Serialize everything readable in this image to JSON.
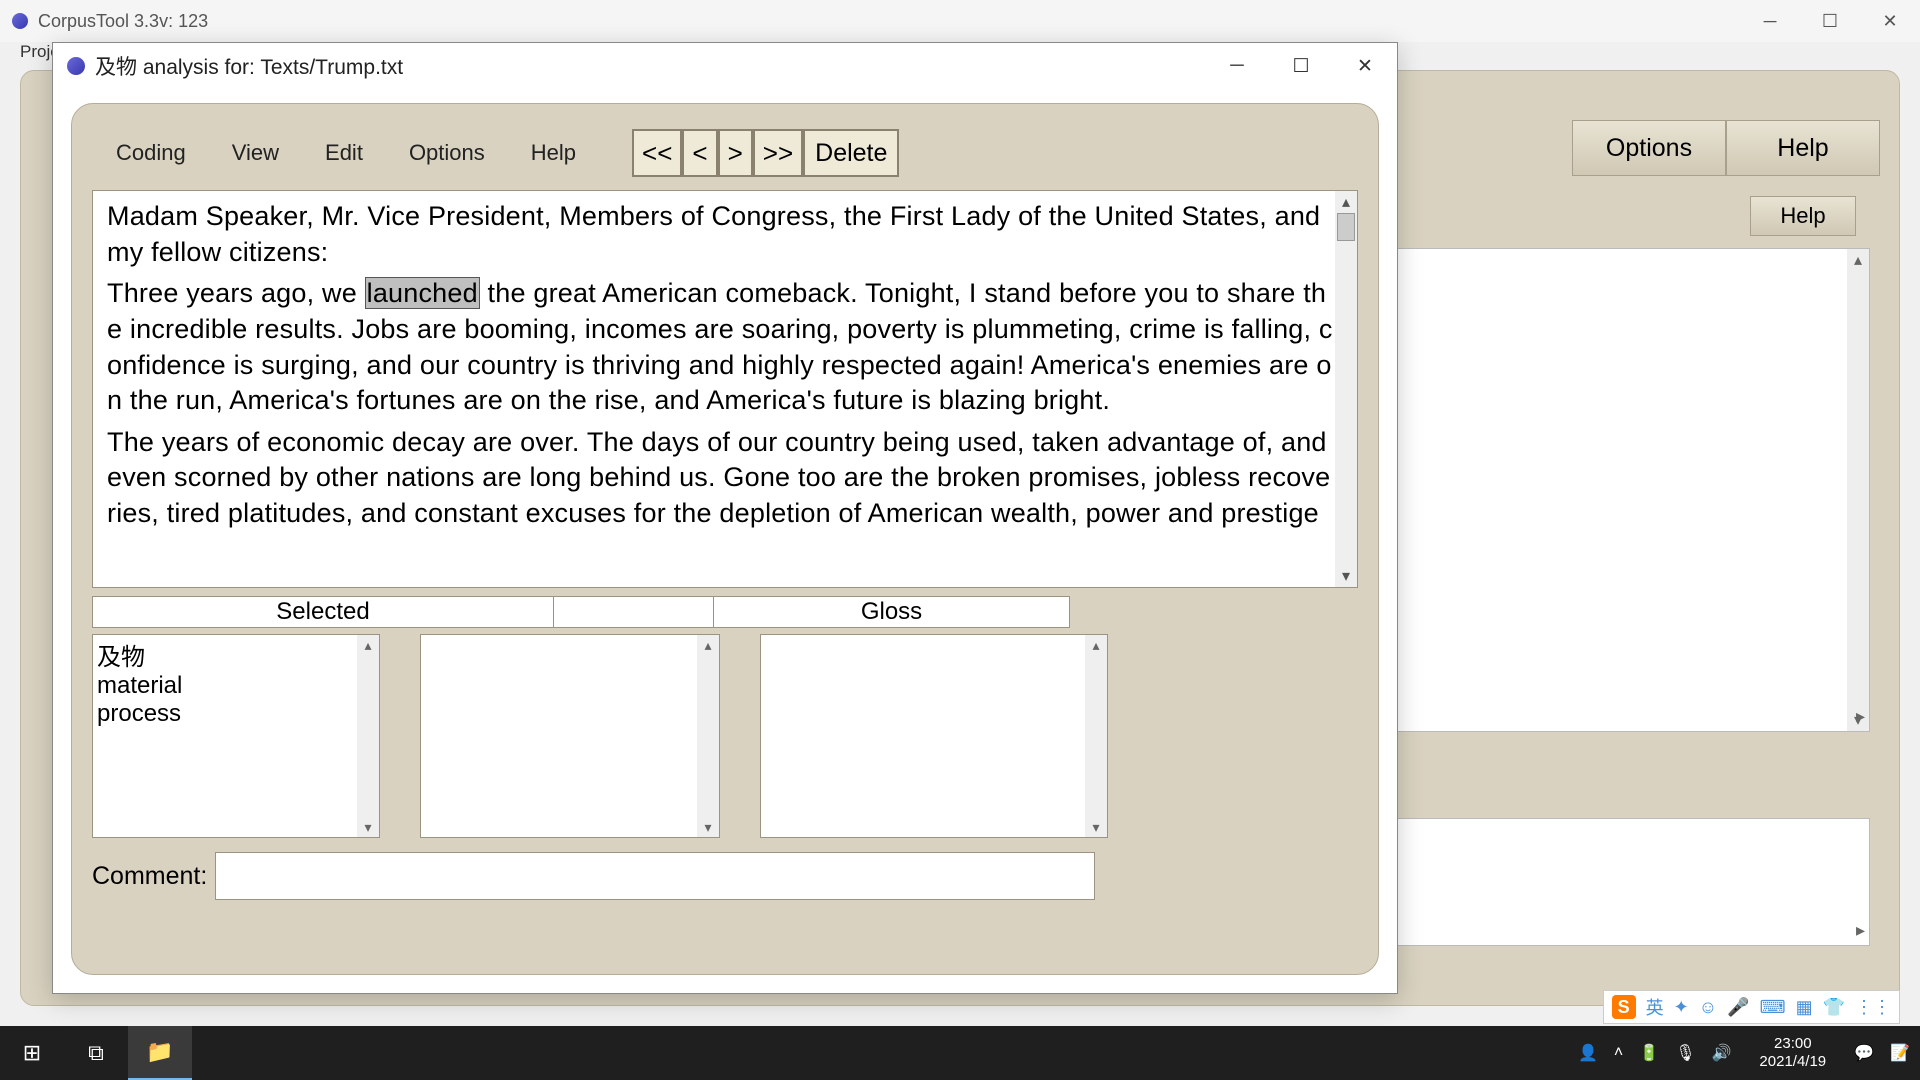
{
  "outer": {
    "title": "CorpusTool 3.3v: 123",
    "proj": "Proje",
    "buttons": {
      "options": "Options",
      "help": "Help",
      "help2": "Help"
    }
  },
  "inner": {
    "title": "及物 analysis for: Texts/Trump.txt",
    "menu": {
      "coding": "Coding",
      "view": "View",
      "edit": "Edit",
      "options": "Options",
      "help": "Help"
    },
    "nav": {
      "first": "<<",
      "prev": "<",
      "next": ">",
      "last": ">>",
      "delete": "Delete"
    },
    "text": {
      "p1a": "Madam Speaker, Mr. Vice President, Members of Congress, the First Lady of the United States, and my fellow citizens:",
      "p2a": "Three years ago, we ",
      "p2h": "launched",
      "p2b": " the great American comeback. Tonight, I stand before you to share the incredible results. Jobs are booming, incomes are soaring, poverty is plummeting, crime is falling, confidence is surging, and our country is thriving and highly respected again! America's enemies are on the run, America's fortunes are on the rise, and America's future is blazing bright.",
      "p3": "The years of economic decay are over. The days of our country being used, taken advantage of, and even scorned by other nations are long behind us. Gone too are the broken promises, jobless recoveries, tired platitudes, and constant excuses for the depletion of American wealth, power  and prestige"
    },
    "headers": {
      "selected": "Selected",
      "gloss": "Gloss"
    },
    "selected_list": {
      "l1": "及物",
      "l2": "material",
      "l3": "process"
    },
    "comment_label": "Comment:"
  },
  "ime": {
    "lang": "英"
  },
  "clock": {
    "time": "23:00",
    "date": "2021/4/19"
  }
}
